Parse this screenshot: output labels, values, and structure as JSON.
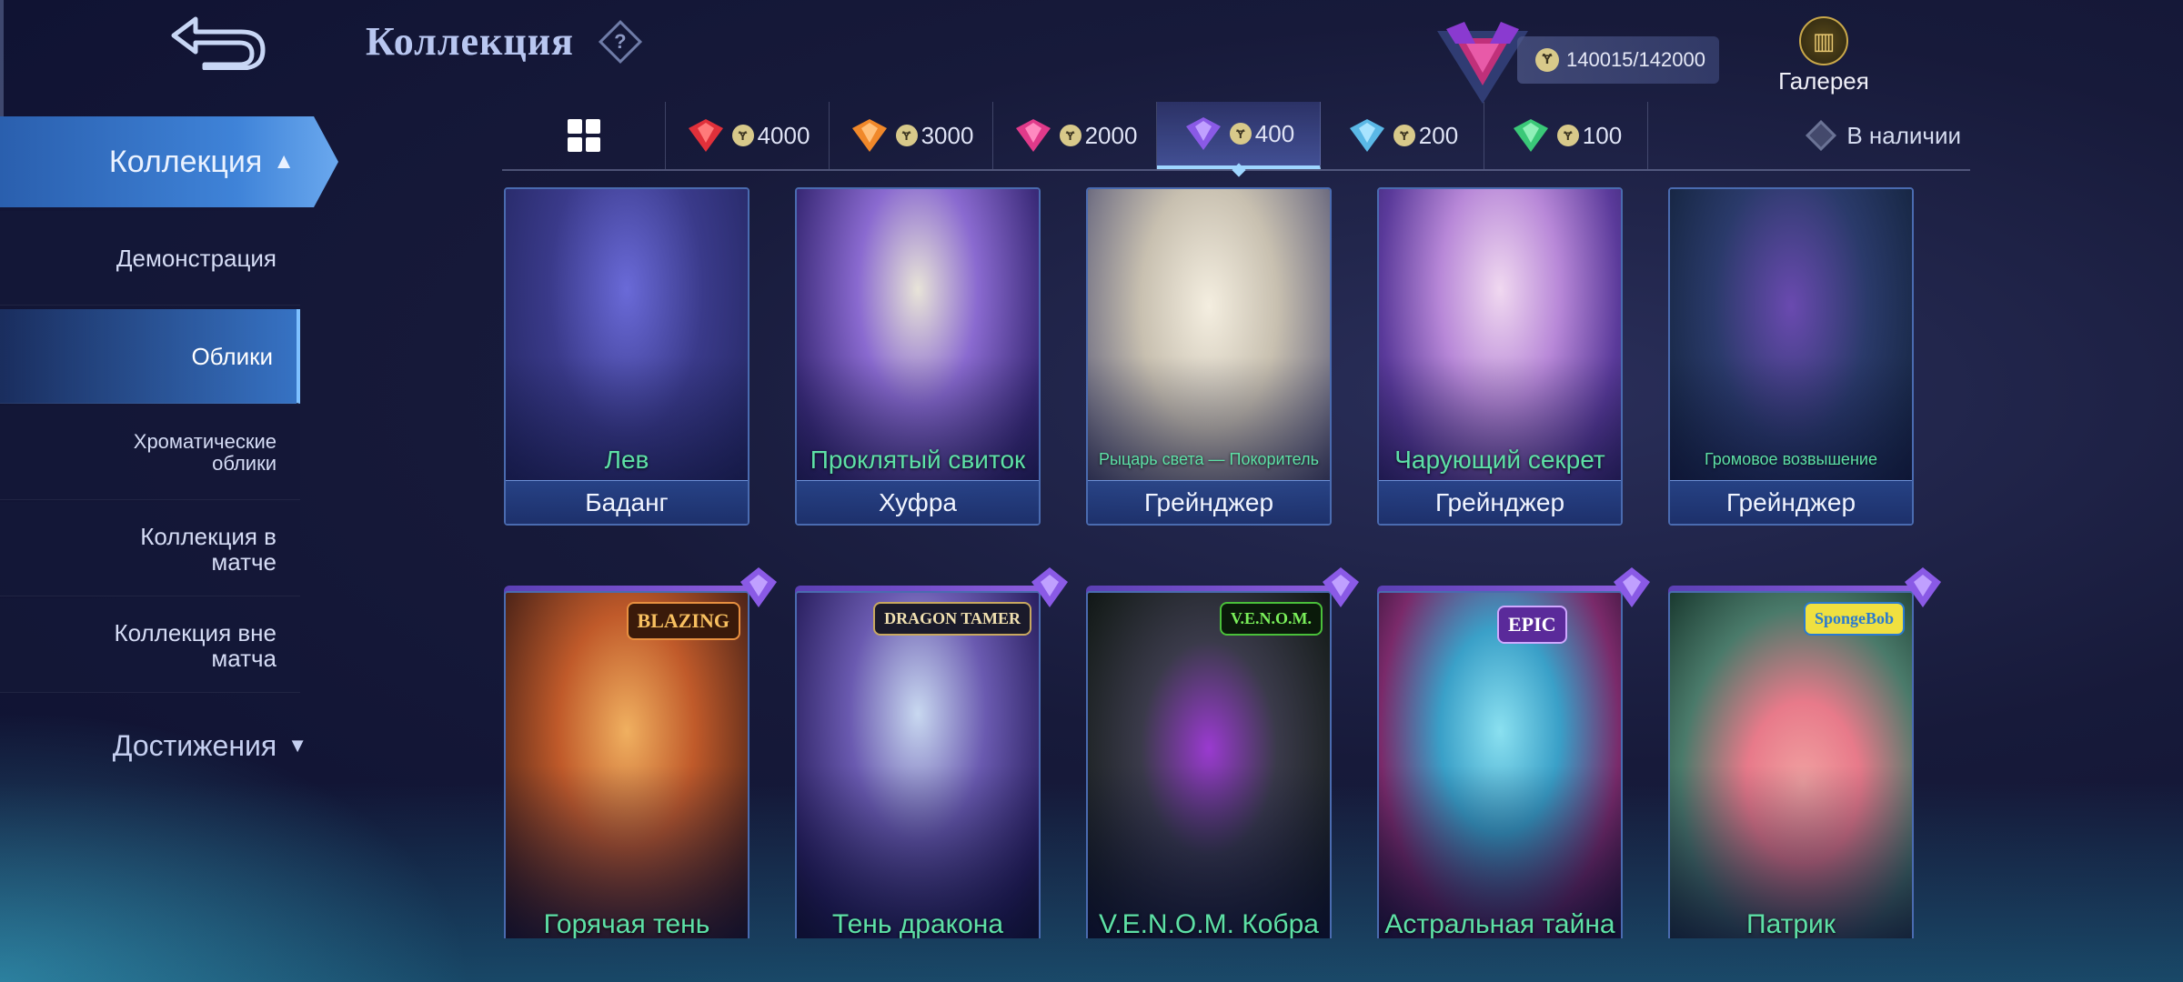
{
  "header": {
    "title": "Коллекция",
    "points": "140015/142000",
    "gallery_label": "Галерея"
  },
  "sidebar": {
    "main_label": "Коллекция",
    "items": [
      {
        "label": "Демонстрация"
      },
      {
        "label": "Облики"
      },
      {
        "label": "Хроматические облики"
      },
      {
        "label": "Коллекция в матче"
      },
      {
        "label": "Коллекция вне матча"
      }
    ],
    "achievements_label": "Достижения"
  },
  "tabs": [
    {
      "price": "4000",
      "gem_color": "#e0303a"
    },
    {
      "price": "3000",
      "gem_color": "#f0882a"
    },
    {
      "price": "2000",
      "gem_color": "#e03a8a"
    },
    {
      "price": "400",
      "gem_color": "#8a5ae6"
    },
    {
      "price": "200",
      "gem_color": "#5ab8e6"
    },
    {
      "price": "100",
      "gem_color": "#3ac878"
    }
  ],
  "filter_label": "В наличии",
  "cards_row1": [
    {
      "skin": "Лев",
      "hero": "Баданг"
    },
    {
      "skin": "Проклятый свиток",
      "hero": "Хуфра"
    },
    {
      "skin": "Рыцарь света — Покоритель",
      "hero": "Грейнджер"
    },
    {
      "skin": "Чарующий секрет",
      "hero": "Грейнджер"
    },
    {
      "skin": "Громовое возвышение",
      "hero": "Грейнджер"
    }
  ],
  "cards_row2": [
    {
      "skin": "Горячая тень",
      "badge": "BLAZING"
    },
    {
      "skin": "Тень дракона",
      "badge": "DRAGON TAMER"
    },
    {
      "skin": "V.E.N.O.M. Кобра",
      "badge": "V.E.N.O.M."
    },
    {
      "skin": "Астральная тайна",
      "badge": "EPIC"
    },
    {
      "skin": "Патрик",
      "badge": "SpongeBob"
    }
  ],
  "colors": {
    "accent": "#3f83d8",
    "skin_name": "#5de0a6",
    "card_border": "#4a6bb0"
  }
}
